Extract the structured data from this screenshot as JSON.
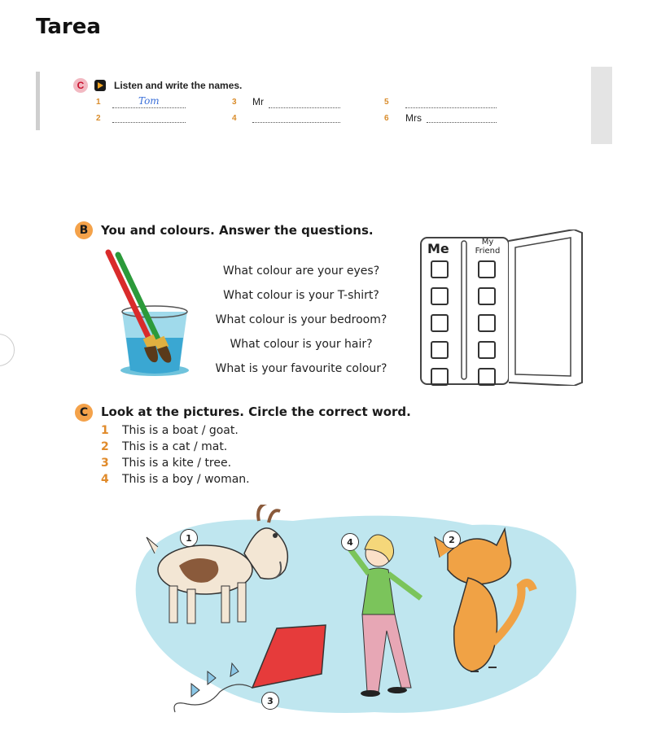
{
  "page_title": "Tarea",
  "ex1": {
    "badge": "C",
    "instruction": "Listen and write the names.",
    "items": [
      {
        "num": "1",
        "prefix": "",
        "answer": "Tom"
      },
      {
        "num": "2",
        "prefix": "",
        "answer": ""
      },
      {
        "num": "3",
        "prefix": "Mr",
        "answer": ""
      },
      {
        "num": "4",
        "prefix": "",
        "answer": ""
      },
      {
        "num": "5",
        "prefix": "",
        "answer": ""
      },
      {
        "num": "6",
        "prefix": "Mrs",
        "answer": ""
      }
    ]
  },
  "ex2": {
    "badge": "B",
    "title": "You and colours. Answer the questions.",
    "questions": [
      "What colour are your eyes?",
      "What colour is your T-shirt?",
      "What colour is your bedroom?",
      "What colour is your hair?",
      "What is your favourite colour?"
    ],
    "table_me": "Me",
    "table_friend": "My Friend"
  },
  "ex3": {
    "badge": "C",
    "title": "Look at the pictures. Circle the correct word.",
    "items": [
      {
        "num": "1",
        "text": "This is a boat / goat."
      },
      {
        "num": "2",
        "text": "This is a cat / mat."
      },
      {
        "num": "3",
        "text": "This is a kite / tree."
      },
      {
        "num": "4",
        "text": "This is a boy / woman."
      }
    ],
    "picture_labels": [
      "1",
      "4",
      "2",
      "3"
    ]
  },
  "colors": {
    "badge_orange": "#f4a24a",
    "number_orange": "#e08a2a",
    "blob_blue": "#bfe6ef"
  }
}
